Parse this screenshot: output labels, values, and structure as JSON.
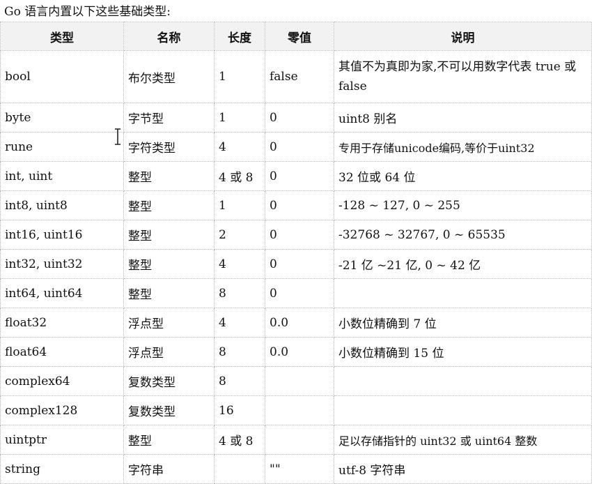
{
  "intro": "Go 语言内置以下这些基础类型:",
  "headers": [
    "类型",
    "名称",
    "长度",
    "零值",
    "说明"
  ],
  "rows": [
    [
      "bool",
      "布尔类型",
      "1",
      "false",
      "其值不为真即为家,不可以用数字代表 true 或 false"
    ],
    [
      "byte",
      "字节型",
      "1",
      "0",
      "uint8 别名"
    ],
    [
      "rune",
      "字符类型",
      "4",
      "0",
      "专用于存储unicode编码,等价于uint32"
    ],
    [
      "int, uint",
      "整型",
      "4 或 8",
      "0",
      "32 位或 64 位"
    ],
    [
      "int8, uint8",
      "整型",
      "1",
      "0",
      "-128 ~ 127, 0 ~ 255"
    ],
    [
      "int16, uint16",
      "整型",
      "2",
      "0",
      "-32768 ~ 32767, 0 ~ 65535"
    ],
    [
      "int32, uint32",
      "整型",
      "4",
      "0",
      "-21 亿 ~21 亿, 0 ~ 42 亿"
    ],
    [
      "int64, uint64",
      "整型",
      "8",
      "0",
      ""
    ],
    [
      "float32",
      "浮点型",
      "4",
      "0.0",
      "小数位精确到 7 位"
    ],
    [
      "float64",
      "浮点型",
      "8",
      "0.0",
      "小数位精确到 15 位"
    ],
    [
      "complex64",
      "复数类型",
      "8",
      "",
      ""
    ],
    [
      "complex128",
      "复数类型",
      "16",
      "",
      ""
    ],
    [
      "uintptr",
      "整型",
      "4 或 8",
      "",
      "足以存储指针的 uint32 或 uint64 整数"
    ],
    [
      "string",
      "字符串",
      "",
      "\"\"",
      "utf-8 字符串"
    ]
  ]
}
